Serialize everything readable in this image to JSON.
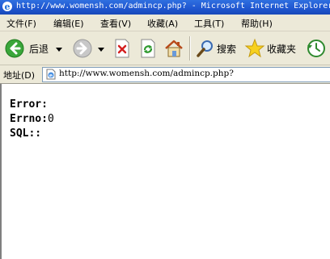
{
  "window": {
    "title": "http://www.womensh.com/admincp.php? - Microsoft Internet Explorer"
  },
  "menu": {
    "items": [
      "文件(F)",
      "编辑(E)",
      "查看(V)",
      "收藏(A)",
      "工具(T)",
      "帮助(H)"
    ]
  },
  "toolbar": {
    "back_label": "后退",
    "search_label": "搜索",
    "favorites_label": "收藏夹"
  },
  "address": {
    "label": "地址(D)",
    "url": "http://www.womensh.com/admincp.php?"
  },
  "page": {
    "error_label": "Error:",
    "errno_label": "Errno:",
    "errno_value": "0",
    "sql_label": "SQL::"
  },
  "colors": {
    "titlebar": "#2058d0",
    "chrome": "#ece9d8",
    "content_bg": "#ffffff"
  }
}
